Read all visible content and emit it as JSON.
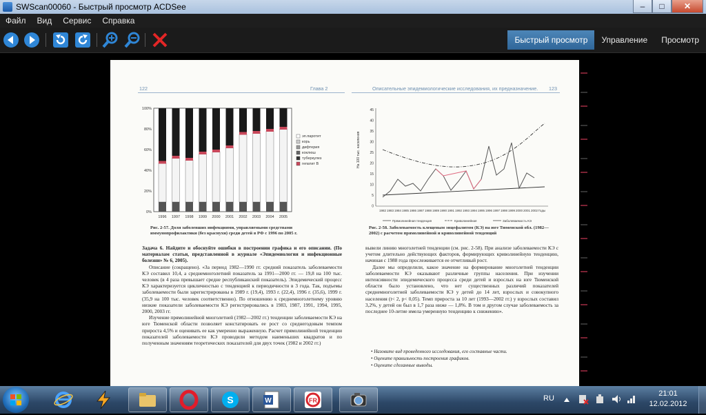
{
  "window": {
    "title": "SWScan00060 - Быстрый просмотр ACDSee"
  },
  "menu": [
    "Файл",
    "Вид",
    "Сервис",
    "Справка"
  ],
  "modes": {
    "quick_view": "Быстрый просмотр",
    "manage": "Управление",
    "view": "Просмотр"
  },
  "toolbar_icons": [
    "arrow-left-icon",
    "arrow-right-icon",
    "rotate-left-icon",
    "rotate-right-icon",
    "zoom-in-icon",
    "zoom-out-icon",
    "delete-icon"
  ],
  "page": {
    "left_num": "122",
    "left_head": "Глава 2",
    "right_head": "Описательные эпидемиологические исследования, их предназначение...",
    "right_num": "123",
    "fig1": {
      "caption": "Рис. 2-57. Доля заболевших инфекциями, управляемыми средствами иммунопрофилактики (без краснухи) среди детей в РФ с 1996 по 2005 г.",
      "legend": [
        "эп.паротит",
        "корь",
        "дифтерия",
        "коклюш",
        "туберкулез",
        "гепатит B"
      ],
      "years": [
        "1996",
        "1997",
        "1998",
        "1999",
        "2000",
        "2001",
        "2002",
        "2003",
        "2004",
        "2005"
      ],
      "ylabels": [
        "100%",
        "80%",
        "60%",
        "40%",
        "20%",
        "0%"
      ]
    },
    "fig2": {
      "caption": "Рис. 2-58. Заболеваемость клещевым энцефалитом (КЭ) на юге Тюменской обл. (1982—2002) с расчетом прямолинейной и криволинейной тенденций",
      "yaxis_label": "На 100 тыс. населения",
      "ylabels": [
        "45",
        "40",
        "35",
        "30",
        "25",
        "20",
        "15",
        "10",
        "5",
        "0"
      ],
      "years": [
        "1982",
        "1983",
        "1984",
        "1985",
        "1986",
        "1987",
        "1988",
        "1989",
        "1990",
        "1991",
        "1992",
        "1993",
        "1994",
        "1995",
        "1996",
        "1997",
        "1998",
        "1999",
        "2000",
        "2001",
        "2002",
        "Годы"
      ],
      "legend": [
        "Прямолинейная тенденция",
        "Криволинейная",
        "Заболеваемость КЭ"
      ]
    },
    "left_text": [
      "Задача 6. Найдите и обоснуйте ошибки в построении графика и его описании. (По материалам статьи, представленной в журнале «Эпидемиология и инфекционные болезни» № 6, 2005).",
      "Описание (сокращено). «За период 1982—1990 гг. средний показатель заболеваемости КЭ составил 10,4, а среднемноголетний показатель за 1991—2000 гг. — 19,8 на 100 тыс. человек (в 4 раза превышает средне республиканский показатель). Эпидемический процесс КЭ характеризуется цикличностью с тенденцией к периодичности в 3 года. Так, подъемы заболеваемости были зарегистрированы в 1989 г. (19,4), 1993 г. (22,4), 1996 г. (35,6), 1999 г. (35,9 на 100 тыс. человек соответственно). По отношению к среднемноголетнему уровню низкие показатели заболеваемости КЭ регистрировались в 1983, 1987, 1991, 1994, 1995, 2000, 2003 гг.",
      "Изучение прямолинейной многолетней (1982—2002 гг.) тенденции заболеваемости КЭ на юге Тюменской области позволяет констатировать ее рост со среднегодовым темпом прироста 4,5% и оценивать ее как умеренно выраженную. Расчет прямолинейной тенденции показателей заболеваемости КЭ проводили методом наименьших квадратов и по полученным значениям теоретических показателей для двух точек (1982 и 2002 гг.)"
    ],
    "right_text": [
      "вывели линию многолетней тенденции (см. рис. 2-58). При анализе заболеваемости КЭ с учетом длительно действующих факторов, формирующих криволинейную тенденцию, начиная с 1988 года прослеживается ее отчетливый рост.",
      "Далее мы определили, какое значение на формирование многолетней тенденции заболеваемости КЭ оказывают различные группы населения. При изучении интенсивности эпидемического процесса среди детей и взрослых на юге Тюменской области было установлено, что нет существенных различий показателей среднемноголетней заболеваемости КЭ у детей до 14 лет, взрослых и совокупного населения (t< 2, p< 0,05). Темп прироста за 10 лет (1993—2002 гг.) у взрослых составил 3,2%, у детей он был в 1,7 раза ниже — 1,8%. В том и другом случае заболеваемость за последнее 10-летие имела умеренную тенденцию к снижению»."
    ],
    "bullets": [
      "Назовите вид проведенного исследования, его составные части.",
      "Оцените правильность построения графиков.",
      "Оцените сделанные выводы."
    ]
  },
  "taskbar": {
    "apps": [
      "internet-explorer-icon",
      "winamp-icon",
      "explorer-folder-icon",
      "opera-icon",
      "skype-icon",
      "word-icon",
      "finereader-icon",
      "acdsee-icon"
    ],
    "lang": "RU",
    "time": "21:01",
    "date": "12.02.2012"
  },
  "colors": {
    "accent": "#3a74a8",
    "taskbar": "#2c4767",
    "close": "#c74a2f",
    "toolbar_icon": "#2f86d6",
    "delete": "#e32626"
  }
}
